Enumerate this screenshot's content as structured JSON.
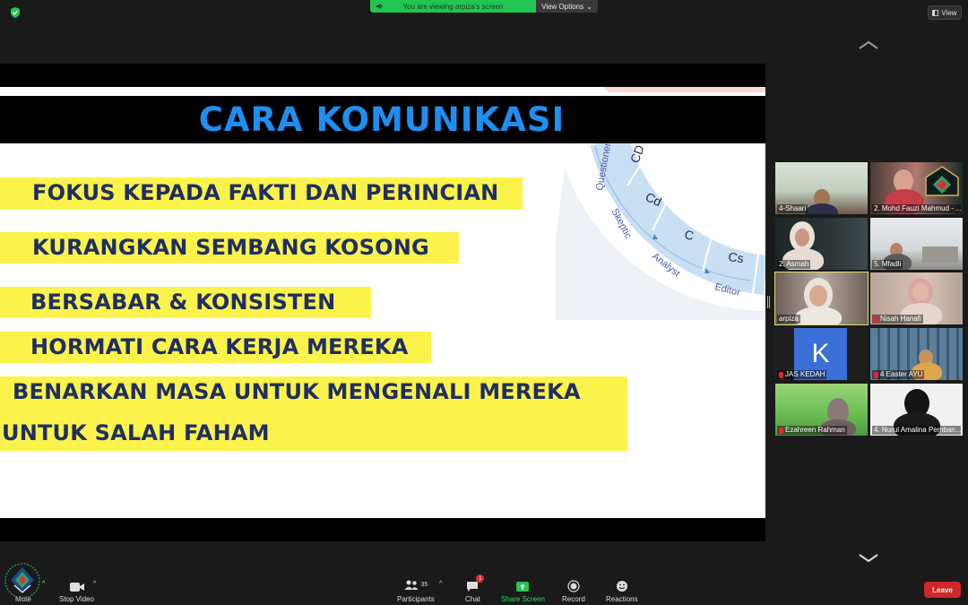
{
  "top": {
    "banner": "You are viewing arpiza's screen",
    "view_options": "View Options",
    "view_button": "View"
  },
  "slide": {
    "title": "CARA KOMUNIKASI",
    "bullets": [
      "FOKUS KEPADA FAKTI DAN PERINCIAN",
      "KURANGKAN SEMBANG KOSONG",
      "BERSABAR & KONSISTEN",
      "HORMATI CARA KERJA MEREKA",
      "BENARKAN MASA UNTUK MENGENALI MEREKA",
      "UNTUK SALAH FAHAM"
    ],
    "wheel_labels": [
      "Questioner",
      "Skeptic",
      "Analyst",
      "Editor",
      "CD",
      "Cd",
      "C",
      "Cs"
    ]
  },
  "participants": [
    {
      "name": "4-Shaari",
      "muted": false
    },
    {
      "name": "2. Mohd Fauzi Mahmud - ...",
      "muted": false
    },
    {
      "name": "2. Asmah",
      "muted": false
    },
    {
      "name": "5. Mfadli",
      "muted": false
    },
    {
      "name": "arpiza",
      "muted": false
    },
    {
      "name": "Nisah Hanafi",
      "muted": true
    },
    {
      "name": "JAS KEDAH",
      "muted": true,
      "avatar_letter": "K"
    },
    {
      "name": "4 Easter AYU",
      "muted": true
    },
    {
      "name": "Ezahreen Rahman",
      "muted": true
    },
    {
      "name": "4. Nurul Amalina Pemban...",
      "muted": false
    }
  ],
  "toolbar": {
    "mute": "Mute",
    "stop_video": "Stop Video",
    "participants": "Participants",
    "participants_count": "35",
    "chat": "Chat",
    "chat_badge": "1",
    "share_screen": "Share Screen",
    "record": "Record",
    "reactions": "Reactions",
    "leave": "Leave"
  },
  "colors": {
    "share_green": "#23c552",
    "title_blue": "#1e8ff0",
    "highlight_yellow": "#fbf34c",
    "bullet_navy": "#1f2f62",
    "leave_red": "#d12727",
    "active_speaker": "#d7e36a"
  }
}
